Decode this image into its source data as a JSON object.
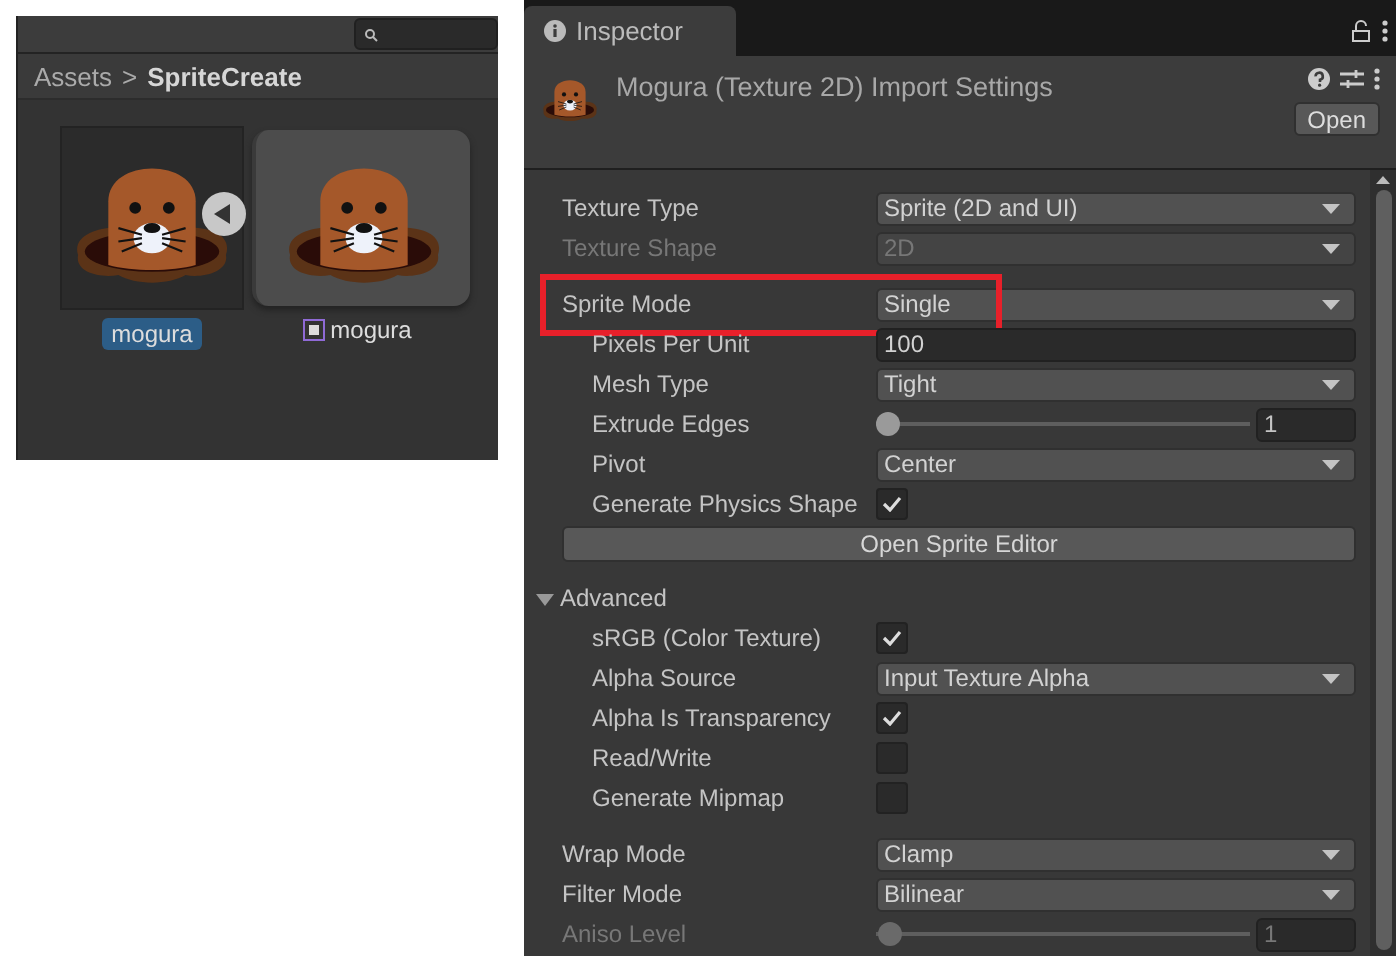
{
  "browser": {
    "breadcrumb": {
      "parent": "Assets",
      "separator": ">",
      "current": "SpriteCreate"
    },
    "assets": [
      {
        "label": "mogura",
        "kind": "texture",
        "selected": true
      },
      {
        "label": "mogura",
        "kind": "sprite",
        "selected": false
      }
    ]
  },
  "inspector": {
    "tab": {
      "title": "Inspector",
      "selected": true
    },
    "title": "Mogura (Texture 2D) Import Settings",
    "open_button": "Open",
    "sections": [
      {
        "rows": [
          {
            "kind": "dropdown",
            "label": "Texture Type",
            "value": "Sprite (2D and UI)",
            "disabled": false
          },
          {
            "kind": "dropdown",
            "label": "Texture Shape",
            "value": "2D",
            "disabled": true
          }
        ]
      },
      {
        "rows": [
          {
            "kind": "dropdown",
            "label": "Sprite Mode",
            "value": "Single",
            "disabled": false,
            "highlighted": true,
            "children": [
              {
                "kind": "text",
                "label": "Pixels Per Unit",
                "value": "100"
              },
              {
                "kind": "dropdown",
                "label": "Mesh Type",
                "value": "Tight",
                "disabled": false
              },
              {
                "kind": "slider",
                "label": "Extrude Edges",
                "level": 0.03,
                "value": "1",
                "disabled": false
              },
              {
                "kind": "dropdown",
                "label": "Pivot",
                "value": "Center",
                "disabled": false
              },
              {
                "kind": "checkbox",
                "label": "Generate Physics Shape",
                "checked": true
              }
            ]
          },
          {
            "kind": "button",
            "label": "Open Sprite Editor"
          },
          {
            "kind": "foldout",
            "label": "Advanced",
            "expanded": true,
            "children": [
              {
                "kind": "checkbox",
                "label": "sRGB (Color Texture)",
                "checked": true
              },
              {
                "kind": "dropdown",
                "label": "Alpha Source",
                "value": "Input Texture Alpha",
                "disabled": false
              },
              {
                "kind": "checkbox",
                "label": "Alpha Is Transparency",
                "checked": true
              },
              {
                "kind": "checkbox",
                "label": "Read/Write",
                "checked": false
              },
              {
                "kind": "checkbox",
                "label": "Generate Mipmap",
                "checked": false
              }
            ]
          }
        ]
      },
      {
        "rows": [
          {
            "kind": "dropdown",
            "label": "Wrap Mode",
            "value": "Clamp",
            "disabled": false
          },
          {
            "kind": "dropdown",
            "label": "Filter Mode",
            "value": "Bilinear",
            "disabled": false
          },
          {
            "kind": "slider",
            "label": "Aniso Level",
            "level": 0.04,
            "value": "1",
            "disabled": true
          }
        ]
      }
    ]
  }
}
